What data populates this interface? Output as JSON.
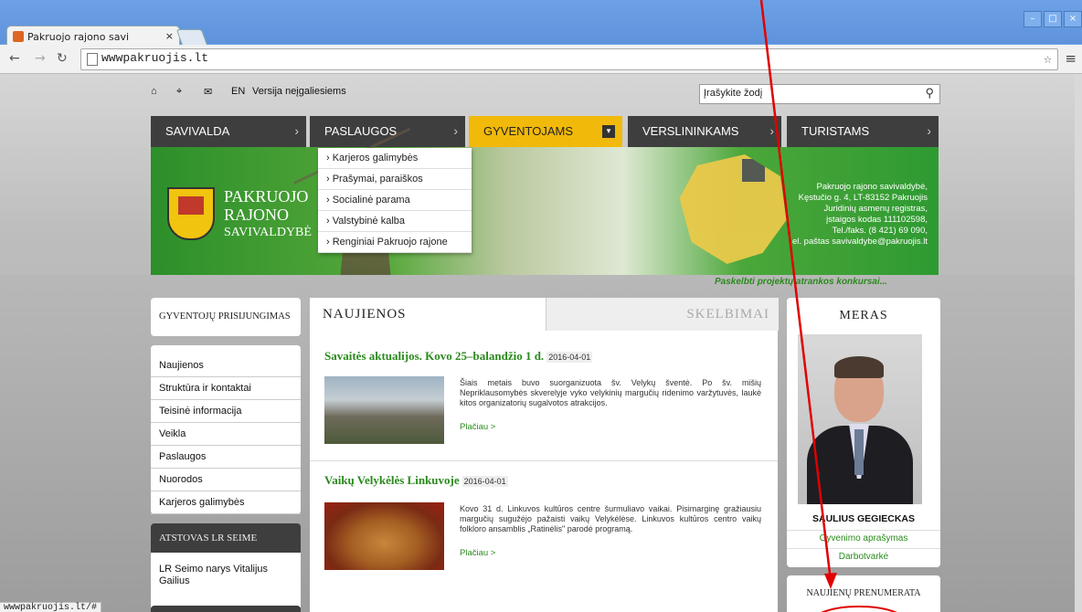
{
  "browser": {
    "tab_title": "Pakruojo rajono savi",
    "tab_close": "×",
    "url": "wwwpakruojis.lt",
    "back_icon": "←",
    "forward_icon": "→",
    "reload_icon": "↻",
    "star_icon": "☆",
    "menu_icon": "≡",
    "window_controls": [
      "–",
      "□",
      "×"
    ],
    "status_url": "wwwpakruojis.lt/#"
  },
  "topbar": {
    "home_icon": "⌂",
    "sitemap_icon": "⌖",
    "mail_icon": "✉",
    "lang": "EN",
    "accessibility": "Versija neįgaliesiems",
    "search_placeholder": "Įrašykite žodį",
    "search_icon": "⚲"
  },
  "nav": {
    "items": [
      "SAVIVALDA",
      "PASLAUGOS",
      "GYVENTOJAMS",
      "VERSLININKAMS",
      "TURISTAMS"
    ],
    "chevron": "›",
    "active_marker": "▾"
  },
  "dropdown": {
    "items": [
      "› Karjeros galimybės",
      "› Prašymai, paraiškos",
      "› Socialinė parama",
      "› Valstybinė kalba",
      "› Renginiai Pakruojo rajone"
    ]
  },
  "banner": {
    "name_line1": "PAKRUOJO",
    "name_line2": "RAJONO",
    "name_line3": "SAVIVALDYBĖ",
    "info_lines": [
      "Pakruojo rajono savivaldybė,",
      "Kęstučio g. 4, LT-83152 Pakruojis",
      "Juridinių asmenų registras,",
      "įstaigos kodas 111102598,",
      "Tel./faks. (8 421) 69 090,",
      "el. paštas savivaldybe@pakruojis.lt"
    ],
    "link": "Paskelbti projektų atrankos konkursai..."
  },
  "sidebar": {
    "login": "GYVENTOJŲ PRISIJUNGIMAS",
    "menu": [
      "Naujienos",
      "Struktūra ir kontaktai",
      "Teisinė informacija",
      "Veikla",
      "Paslaugos",
      "Nuorodos",
      "Karjeros galimybės"
    ],
    "seimas_title": "ATSTOVAS LR SEIME",
    "seimas_member": "LR Seimo narys Vitalijus Gailius"
  },
  "center": {
    "tab_news": "NAUJIENOS",
    "tab_notices": "SKELBIMAI",
    "news": [
      {
        "title": "Savaitės aktualijos. Kovo 25–balandžio 1 d.",
        "date": "2016-04-01",
        "text": "Šiais metais buvo suorganizuota šv. Velykų šventė. Po šv. mišių Nepriklausomybės skverelyje vyko velykinių margučių ridenimo varžytuvės, laukė kitos organizatorių sugalvotos atrakcijos.",
        "more": "Plačiau >"
      },
      {
        "title": "Vaikų Velykėlės Linkuvoje",
        "date": "2016-04-01",
        "text": "Kovo 31 d. Linkuvos kultūros centre šurmuliavo vaikai. Pisimarginę gražiausiu margučių sugužėjo pažaisti vaikų Velykėlėse. Linkuvos kultūros centro vaikų folkloro ansamblis „Ratinėlis\" parodė programą.",
        "more": "Plačiau >"
      }
    ]
  },
  "right": {
    "mayor_title": "MERAS",
    "mayor_name": "SAULIUS GEGIECKAS",
    "bio_link": "Gyvenimo aprašymas",
    "schedule_link": "Darbotvarkė",
    "subscribe_title": "NAUJIENŲ PRENUMERATA"
  },
  "colors": {
    "nav_bg": "#3e3e3e",
    "nav_active": "#f1b90a",
    "accent_green": "#2a8a1c",
    "annotation_red": "#e00000"
  }
}
